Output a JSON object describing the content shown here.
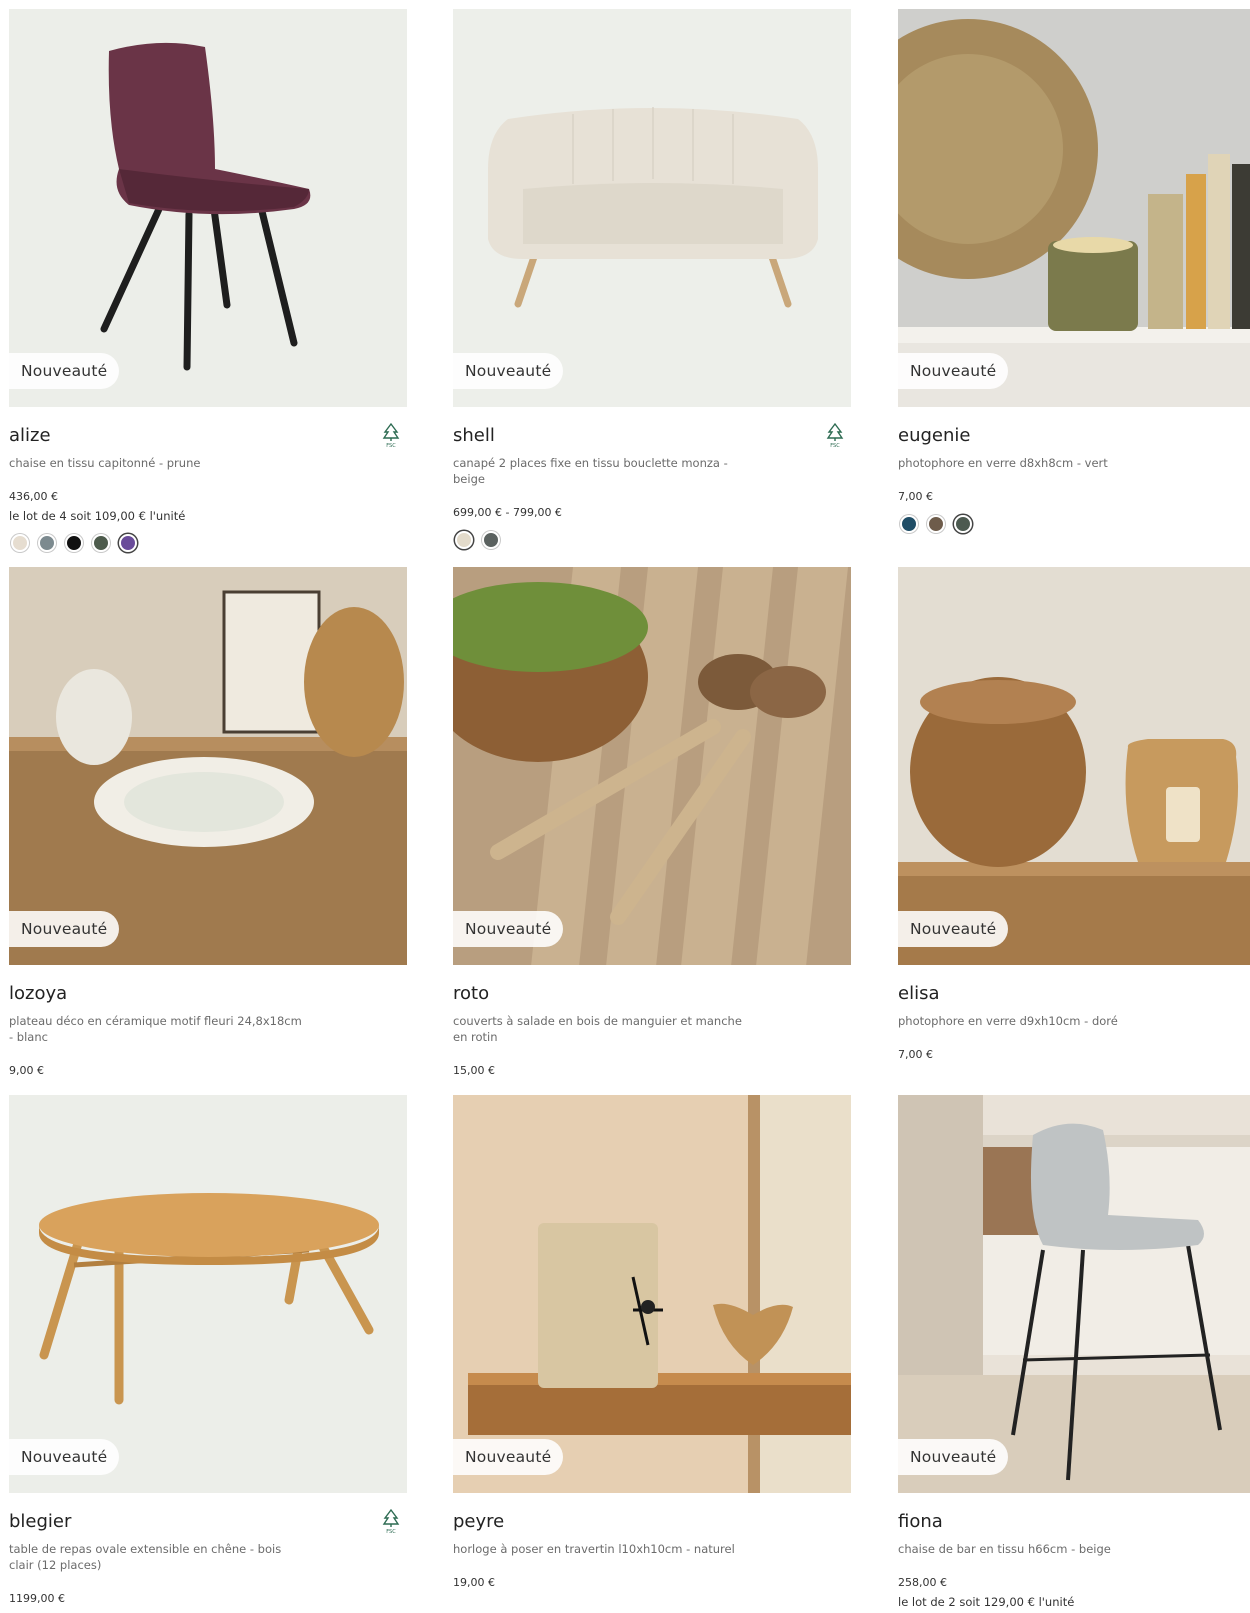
{
  "badge_label": "Nouveauté",
  "products": [
    {
      "name": "alize",
      "description": "chaise en tissu capitonné - prune",
      "price": "436,00 €",
      "lot_text": "le lot de 4 soit 109,00 € l'unité",
      "fsc": true,
      "swatches": [
        "#e6ddd0",
        "#7c8a8f",
        "#111111",
        "#4d5b4c",
        "#6a4c9a"
      ],
      "selected_swatch": 4
    },
    {
      "name": "shell",
      "description": "canapé 2 places fixe en tissu bouclette monza - beige",
      "price": "699,00 € - 799,00 €",
      "lot_text": "",
      "fsc": true,
      "swatches": [
        "#e3dbcb",
        "#5b6260"
      ],
      "selected_swatch": 0
    },
    {
      "name": "eugenie",
      "description": "photophore en verre d8xh8cm - vert",
      "price": "7,00 €",
      "lot_text": "",
      "fsc": false,
      "swatches": [
        "#1f4d66",
        "#6e5c4b",
        "#4c5a50"
      ],
      "selected_swatch": 2
    },
    {
      "name": "lozoya",
      "description": "plateau déco en céramique motif fleuri 24,8x18cm - blanc",
      "price": "9,00 €",
      "lot_text": "",
      "fsc": false,
      "swatches": [],
      "selected_swatch": -1
    },
    {
      "name": "roto",
      "description": "couverts à salade en bois de manguier et manche en rotin",
      "price": "15,00 €",
      "lot_text": "",
      "fsc": false,
      "swatches": [],
      "selected_swatch": -1
    },
    {
      "name": "elisa",
      "description": "photophore en verre d9xh10cm - doré",
      "price": "7,00 €",
      "lot_text": "",
      "fsc": false,
      "swatches": [],
      "selected_swatch": -1
    },
    {
      "name": "blegier",
      "description": "table de repas ovale extensible en chêne - bois clair (12 places)",
      "price": "1199,00 €",
      "lot_text": "",
      "fsc": true,
      "swatches": [],
      "selected_swatch": -1
    },
    {
      "name": "peyre",
      "description": "horloge à poser en travertin l10xh10cm - naturel",
      "price": "19,00 €",
      "lot_text": "",
      "fsc": false,
      "swatches": [],
      "selected_swatch": -1
    },
    {
      "name": "fiona",
      "description": "chaise de bar en tissu h66cm - beige",
      "price": "258,00 €",
      "lot_text": "le lot de 2 soit 129,00 € l'unité",
      "fsc": false,
      "swatches": [],
      "selected_swatch": -1
    }
  ]
}
